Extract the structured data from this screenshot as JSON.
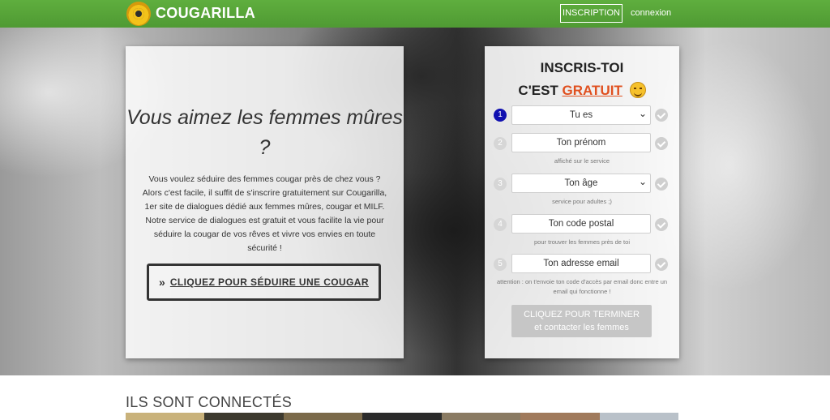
{
  "header": {
    "brand": "COUGARILLA",
    "signup_button": "INSCRIPTION",
    "login_link": "connexion"
  },
  "hero_left": {
    "title": "Vous aimez les femmes mûres ?",
    "paragraph": "Vous voulez séduire des femmes cougar près de chez vous ? Alors c'est facile, il suffit de s'inscrire gratuitement sur Cougarilla, 1er site de dialogues dédié aux femmes mûres, cougar et MILF. Notre service de dialogues est gratuit et vous facilite la vie pour séduire la cougar de vos rêves et vivre vos envies en toute sécurité !",
    "cta_label": "CLIQUEZ POUR SÉDUIRE UNE COUGAR"
  },
  "signup": {
    "title_line1": "INSCRIS-TOI",
    "title_prefix": "C'EST",
    "title_free": "GRATUIT",
    "steps": [
      {
        "number": "1",
        "value": "Tu es",
        "hint": ""
      },
      {
        "number": "2",
        "value": "Ton prénom",
        "hint": "affiché sur le service"
      },
      {
        "number": "3",
        "value": "Ton âge",
        "hint": "service pour adultes ;)"
      },
      {
        "number": "4",
        "value": "Ton code postal",
        "hint": "pour trouver les femmes près de toi"
      },
      {
        "number": "5",
        "value": "Ton adresse email",
        "hint": "attention : on t'envoie ton code d'accès par email donc entre un email qui fonctionne !"
      }
    ],
    "submit_line1": "CLIQUEZ POUR TERMINER",
    "submit_line2": "et contacter les femmes"
  },
  "connected": {
    "title": "ILS SONT CONNECTÉS"
  },
  "colors": {
    "header_green": "#5fae3e",
    "accent_orange": "#e0501f",
    "step_active": "#1010b0"
  }
}
